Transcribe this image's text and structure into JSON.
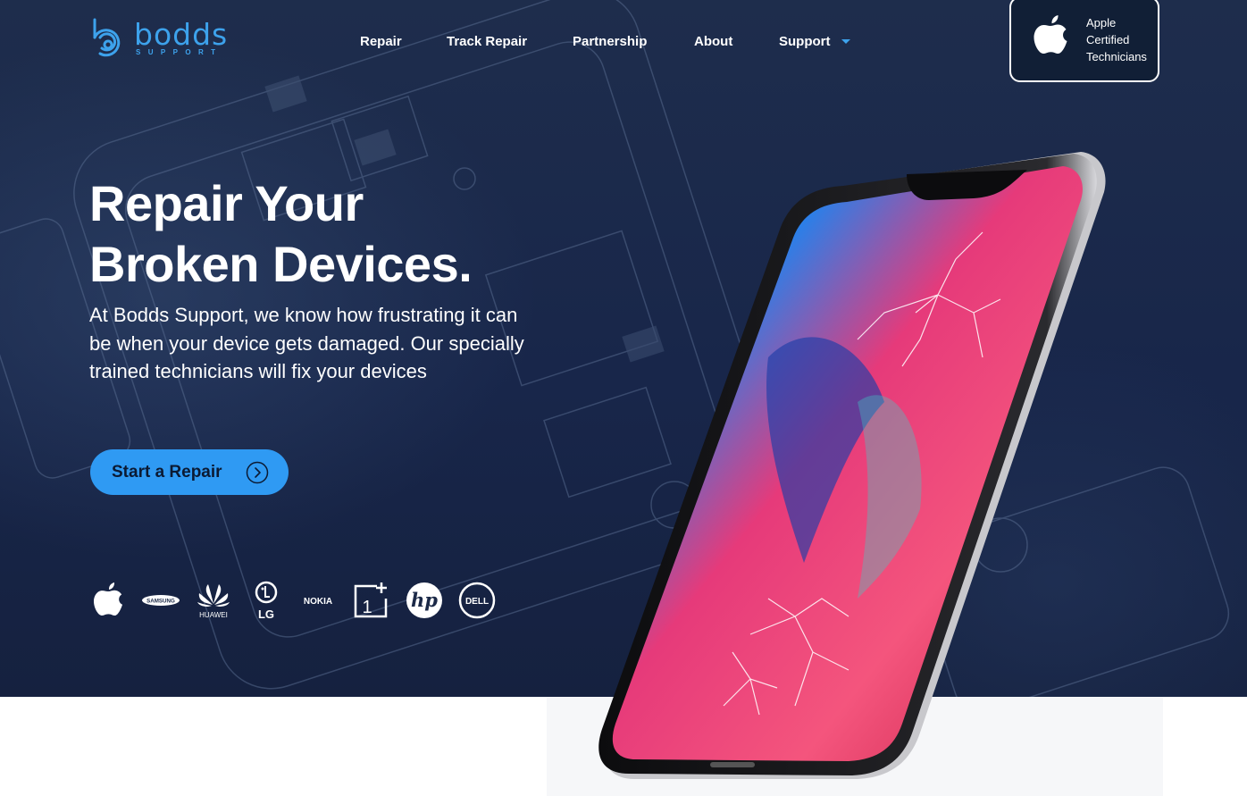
{
  "brand": {
    "logo_text": "bodds",
    "logo_subtext": "SUPPORT"
  },
  "nav": {
    "items": [
      {
        "label": "Repair"
      },
      {
        "label": "Track Repair"
      },
      {
        "label": "Partnership"
      },
      {
        "label": "About"
      },
      {
        "label": "Support",
        "has_dropdown": true
      }
    ]
  },
  "badge": {
    "line1": "Apple",
    "line2": "Certified",
    "line3": "Technicians",
    "icon": "apple-icon"
  },
  "hero": {
    "title_line1": "Repair Your",
    "title_line2": "Broken Devices.",
    "body": "At Bodds Support, we know how frustrating it can be when your device gets damaged. Our specially trained technicians will fix your devices",
    "cta_label": "Start a Repair",
    "cta_icon": "chevron-right-circle-icon"
  },
  "brand_logos": [
    {
      "name": "apple",
      "text": ""
    },
    {
      "name": "samsung",
      "text": "SAMSUNG"
    },
    {
      "name": "huawei",
      "text": "HUAWEI"
    },
    {
      "name": "lg",
      "text": "LG"
    },
    {
      "name": "nokia",
      "text": "NOKIA"
    },
    {
      "name": "oneplus",
      "text": "1"
    },
    {
      "name": "hp",
      "text": "hp"
    },
    {
      "name": "dell",
      "text": "DELL"
    }
  ],
  "colors": {
    "accent": "#2f9af3",
    "logo": "#3da2ec",
    "hero_bg": "#1b2947",
    "text": "#ffffff"
  }
}
